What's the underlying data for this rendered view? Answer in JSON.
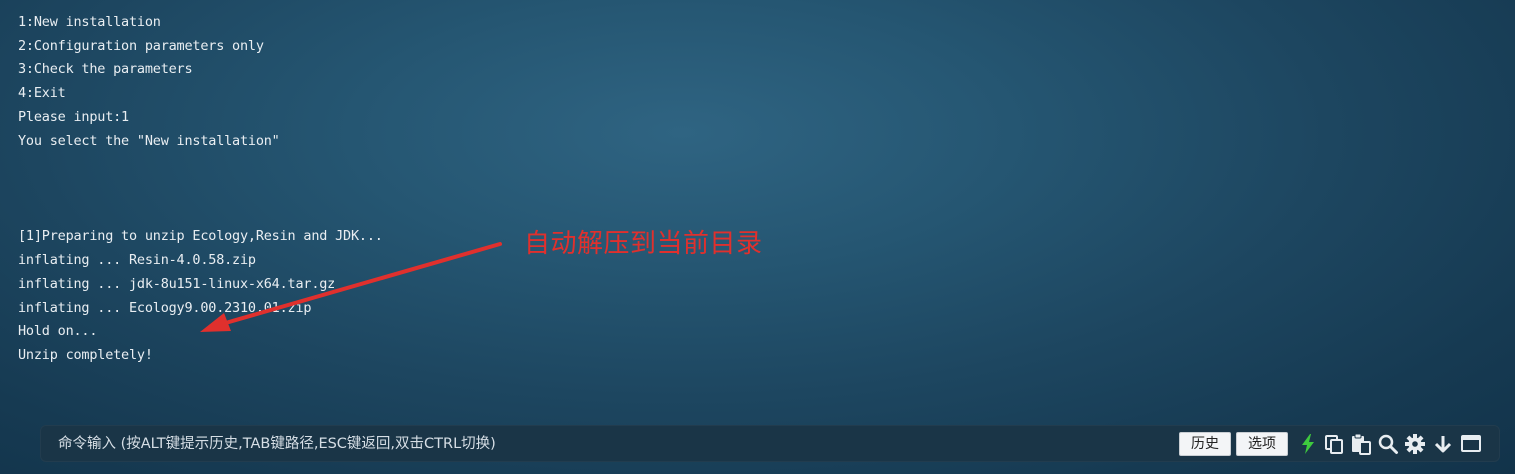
{
  "terminal": {
    "lines": [
      "1:New installation",
      "2:Configuration parameters only",
      "3:Check the parameters",
      "4:Exit",
      "Please input:1",
      "You select the \"New installation\"",
      "",
      "",
      "",
      "[1]Preparing to unzip Ecology,Resin and JDK...",
      "inflating ... Resin-4.0.58.zip",
      "inflating ... jdk-8u151-linux-x64.tar.gz",
      "inflating ... Ecology9.00.2310.01.zip",
      "Hold on...",
      "Unzip completely!"
    ]
  },
  "annotation": {
    "text": "自动解压到当前目录",
    "color": "#e0302d"
  },
  "command_bar": {
    "placeholder": "命令输入 (按ALT键提示历史,TAB键路径,ESC键返回,双击CTRL切换)",
    "history_button": "历史",
    "options_button": "选项",
    "icons": [
      "lightning-icon",
      "copy-icon",
      "paste-icon",
      "search-icon",
      "gear-icon",
      "arrow-down-icon",
      "window-icon"
    ],
    "lightning_color": "#3ec93e"
  }
}
